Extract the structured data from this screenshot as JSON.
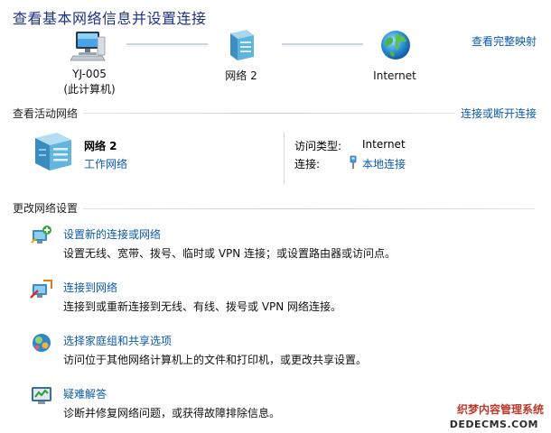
{
  "header": {
    "title": "查看基本网络信息并设置连接",
    "full_map_link": "查看完整映射"
  },
  "network_map": {
    "computer_name": "YJ-005",
    "computer_sub": "(此计算机)",
    "network_name": "网络  2",
    "internet_label": "Internet"
  },
  "active_networks": {
    "section_title": "查看活动网络",
    "connect_link": "连接或断开连接",
    "network_name": "网络  2",
    "network_type": "工作网络",
    "access_type_label": "访问类型:",
    "access_type_value": "Internet",
    "connection_label": "连接:",
    "connection_value": "本地连接"
  },
  "change_settings": {
    "section_title": "更改网络设置",
    "tasks": [
      {
        "title": "设置新的连接或网络",
        "desc": "设置无线、宽带、拨号、临时或 VPN 连接；或设置路由器或访问点。"
      },
      {
        "title": "连接到网络",
        "desc": "连接到或重新连接到无线、有线、拨号或 VPN 网络连接。"
      },
      {
        "title": "选择家庭组和共享选项",
        "desc": "访问位于其他网络计算机上的文件和打印机，或更改共享设置。"
      },
      {
        "title": "疑难解答",
        "desc": "诊断并修复网络问题，或获得故障排除信息。"
      }
    ]
  },
  "watermark": {
    "line1": "织梦内容管理系统",
    "line2": "DEDECMS.COM"
  },
  "colors": {
    "title": "#1e3287",
    "link": "#0b5ab0"
  }
}
